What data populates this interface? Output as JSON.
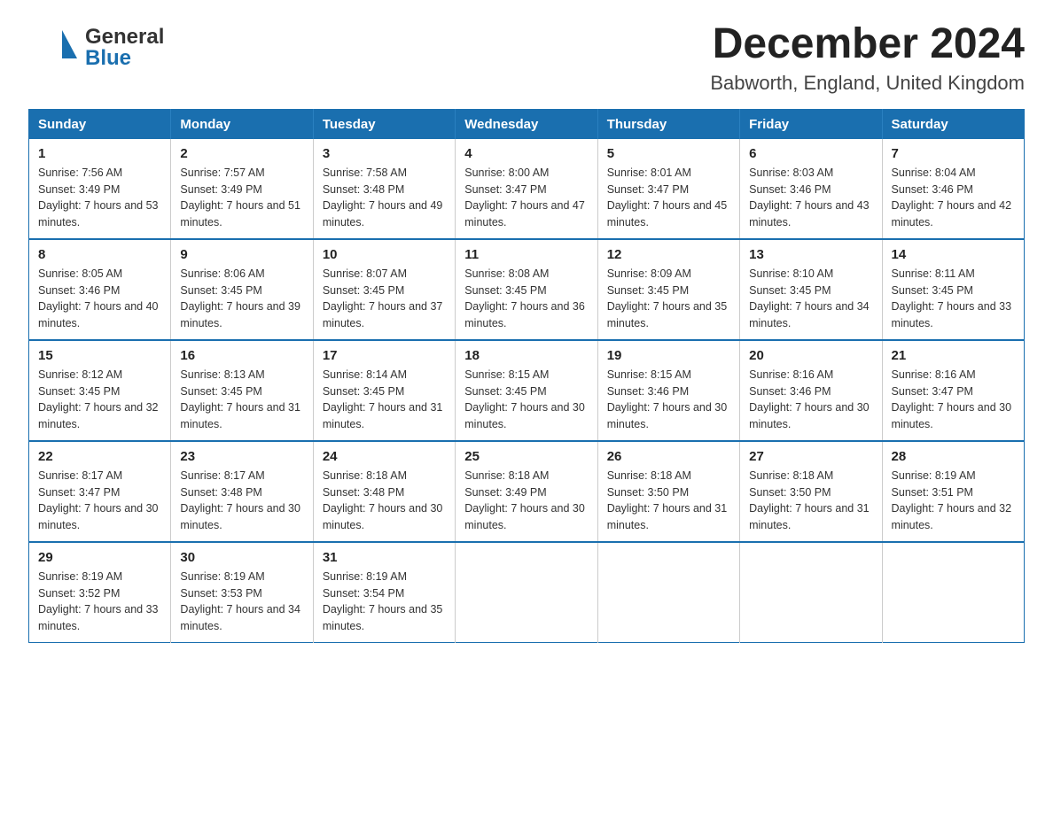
{
  "header": {
    "logo_general": "General",
    "logo_blue": "Blue",
    "title": "December 2024",
    "subtitle": "Babworth, England, United Kingdom"
  },
  "days_of_week": [
    "Sunday",
    "Monday",
    "Tuesday",
    "Wednesday",
    "Thursday",
    "Friday",
    "Saturday"
  ],
  "weeks": [
    [
      {
        "day": "1",
        "sunrise": "Sunrise: 7:56 AM",
        "sunset": "Sunset: 3:49 PM",
        "daylight": "Daylight: 7 hours and 53 minutes."
      },
      {
        "day": "2",
        "sunrise": "Sunrise: 7:57 AM",
        "sunset": "Sunset: 3:49 PM",
        "daylight": "Daylight: 7 hours and 51 minutes."
      },
      {
        "day": "3",
        "sunrise": "Sunrise: 7:58 AM",
        "sunset": "Sunset: 3:48 PM",
        "daylight": "Daylight: 7 hours and 49 minutes."
      },
      {
        "day": "4",
        "sunrise": "Sunrise: 8:00 AM",
        "sunset": "Sunset: 3:47 PM",
        "daylight": "Daylight: 7 hours and 47 minutes."
      },
      {
        "day": "5",
        "sunrise": "Sunrise: 8:01 AM",
        "sunset": "Sunset: 3:47 PM",
        "daylight": "Daylight: 7 hours and 45 minutes."
      },
      {
        "day": "6",
        "sunrise": "Sunrise: 8:03 AM",
        "sunset": "Sunset: 3:46 PM",
        "daylight": "Daylight: 7 hours and 43 minutes."
      },
      {
        "day": "7",
        "sunrise": "Sunrise: 8:04 AM",
        "sunset": "Sunset: 3:46 PM",
        "daylight": "Daylight: 7 hours and 42 minutes."
      }
    ],
    [
      {
        "day": "8",
        "sunrise": "Sunrise: 8:05 AM",
        "sunset": "Sunset: 3:46 PM",
        "daylight": "Daylight: 7 hours and 40 minutes."
      },
      {
        "day": "9",
        "sunrise": "Sunrise: 8:06 AM",
        "sunset": "Sunset: 3:45 PM",
        "daylight": "Daylight: 7 hours and 39 minutes."
      },
      {
        "day": "10",
        "sunrise": "Sunrise: 8:07 AM",
        "sunset": "Sunset: 3:45 PM",
        "daylight": "Daylight: 7 hours and 37 minutes."
      },
      {
        "day": "11",
        "sunrise": "Sunrise: 8:08 AM",
        "sunset": "Sunset: 3:45 PM",
        "daylight": "Daylight: 7 hours and 36 minutes."
      },
      {
        "day": "12",
        "sunrise": "Sunrise: 8:09 AM",
        "sunset": "Sunset: 3:45 PM",
        "daylight": "Daylight: 7 hours and 35 minutes."
      },
      {
        "day": "13",
        "sunrise": "Sunrise: 8:10 AM",
        "sunset": "Sunset: 3:45 PM",
        "daylight": "Daylight: 7 hours and 34 minutes."
      },
      {
        "day": "14",
        "sunrise": "Sunrise: 8:11 AM",
        "sunset": "Sunset: 3:45 PM",
        "daylight": "Daylight: 7 hours and 33 minutes."
      }
    ],
    [
      {
        "day": "15",
        "sunrise": "Sunrise: 8:12 AM",
        "sunset": "Sunset: 3:45 PM",
        "daylight": "Daylight: 7 hours and 32 minutes."
      },
      {
        "day": "16",
        "sunrise": "Sunrise: 8:13 AM",
        "sunset": "Sunset: 3:45 PM",
        "daylight": "Daylight: 7 hours and 31 minutes."
      },
      {
        "day": "17",
        "sunrise": "Sunrise: 8:14 AM",
        "sunset": "Sunset: 3:45 PM",
        "daylight": "Daylight: 7 hours and 31 minutes."
      },
      {
        "day": "18",
        "sunrise": "Sunrise: 8:15 AM",
        "sunset": "Sunset: 3:45 PM",
        "daylight": "Daylight: 7 hours and 30 minutes."
      },
      {
        "day": "19",
        "sunrise": "Sunrise: 8:15 AM",
        "sunset": "Sunset: 3:46 PM",
        "daylight": "Daylight: 7 hours and 30 minutes."
      },
      {
        "day": "20",
        "sunrise": "Sunrise: 8:16 AM",
        "sunset": "Sunset: 3:46 PM",
        "daylight": "Daylight: 7 hours and 30 minutes."
      },
      {
        "day": "21",
        "sunrise": "Sunrise: 8:16 AM",
        "sunset": "Sunset: 3:47 PM",
        "daylight": "Daylight: 7 hours and 30 minutes."
      }
    ],
    [
      {
        "day": "22",
        "sunrise": "Sunrise: 8:17 AM",
        "sunset": "Sunset: 3:47 PM",
        "daylight": "Daylight: 7 hours and 30 minutes."
      },
      {
        "day": "23",
        "sunrise": "Sunrise: 8:17 AM",
        "sunset": "Sunset: 3:48 PM",
        "daylight": "Daylight: 7 hours and 30 minutes."
      },
      {
        "day": "24",
        "sunrise": "Sunrise: 8:18 AM",
        "sunset": "Sunset: 3:48 PM",
        "daylight": "Daylight: 7 hours and 30 minutes."
      },
      {
        "day": "25",
        "sunrise": "Sunrise: 8:18 AM",
        "sunset": "Sunset: 3:49 PM",
        "daylight": "Daylight: 7 hours and 30 minutes."
      },
      {
        "day": "26",
        "sunrise": "Sunrise: 8:18 AM",
        "sunset": "Sunset: 3:50 PM",
        "daylight": "Daylight: 7 hours and 31 minutes."
      },
      {
        "day": "27",
        "sunrise": "Sunrise: 8:18 AM",
        "sunset": "Sunset: 3:50 PM",
        "daylight": "Daylight: 7 hours and 31 minutes."
      },
      {
        "day": "28",
        "sunrise": "Sunrise: 8:19 AM",
        "sunset": "Sunset: 3:51 PM",
        "daylight": "Daylight: 7 hours and 32 minutes."
      }
    ],
    [
      {
        "day": "29",
        "sunrise": "Sunrise: 8:19 AM",
        "sunset": "Sunset: 3:52 PM",
        "daylight": "Daylight: 7 hours and 33 minutes."
      },
      {
        "day": "30",
        "sunrise": "Sunrise: 8:19 AM",
        "sunset": "Sunset: 3:53 PM",
        "daylight": "Daylight: 7 hours and 34 minutes."
      },
      {
        "day": "31",
        "sunrise": "Sunrise: 8:19 AM",
        "sunset": "Sunset: 3:54 PM",
        "daylight": "Daylight: 7 hours and 35 minutes."
      },
      null,
      null,
      null,
      null
    ]
  ]
}
